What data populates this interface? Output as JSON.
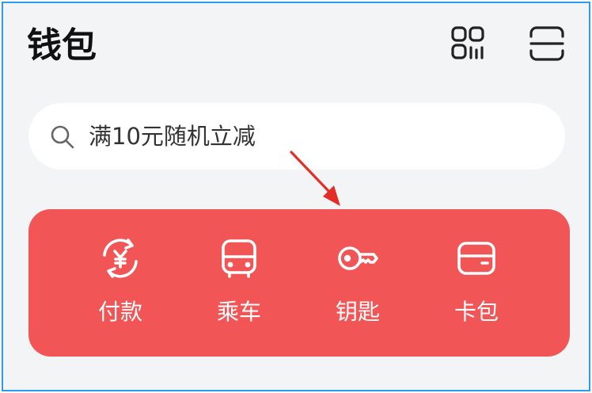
{
  "header": {
    "title": "钱包",
    "icons": [
      "qr-code-icon",
      "scan-icon"
    ]
  },
  "search": {
    "placeholder": "满10元随机立减",
    "icon": "search-icon"
  },
  "quick_actions": [
    {
      "label": "付款",
      "icon": "yuan-refresh-icon"
    },
    {
      "label": "乘车",
      "icon": "bus-icon"
    },
    {
      "label": "钥匙",
      "icon": "key-icon"
    },
    {
      "label": "卡包",
      "icon": "card-wallet-icon"
    }
  ],
  "colors": {
    "accent": "#f25556",
    "background": "#f3f4f6",
    "annotation_arrow": "#e52d27"
  }
}
